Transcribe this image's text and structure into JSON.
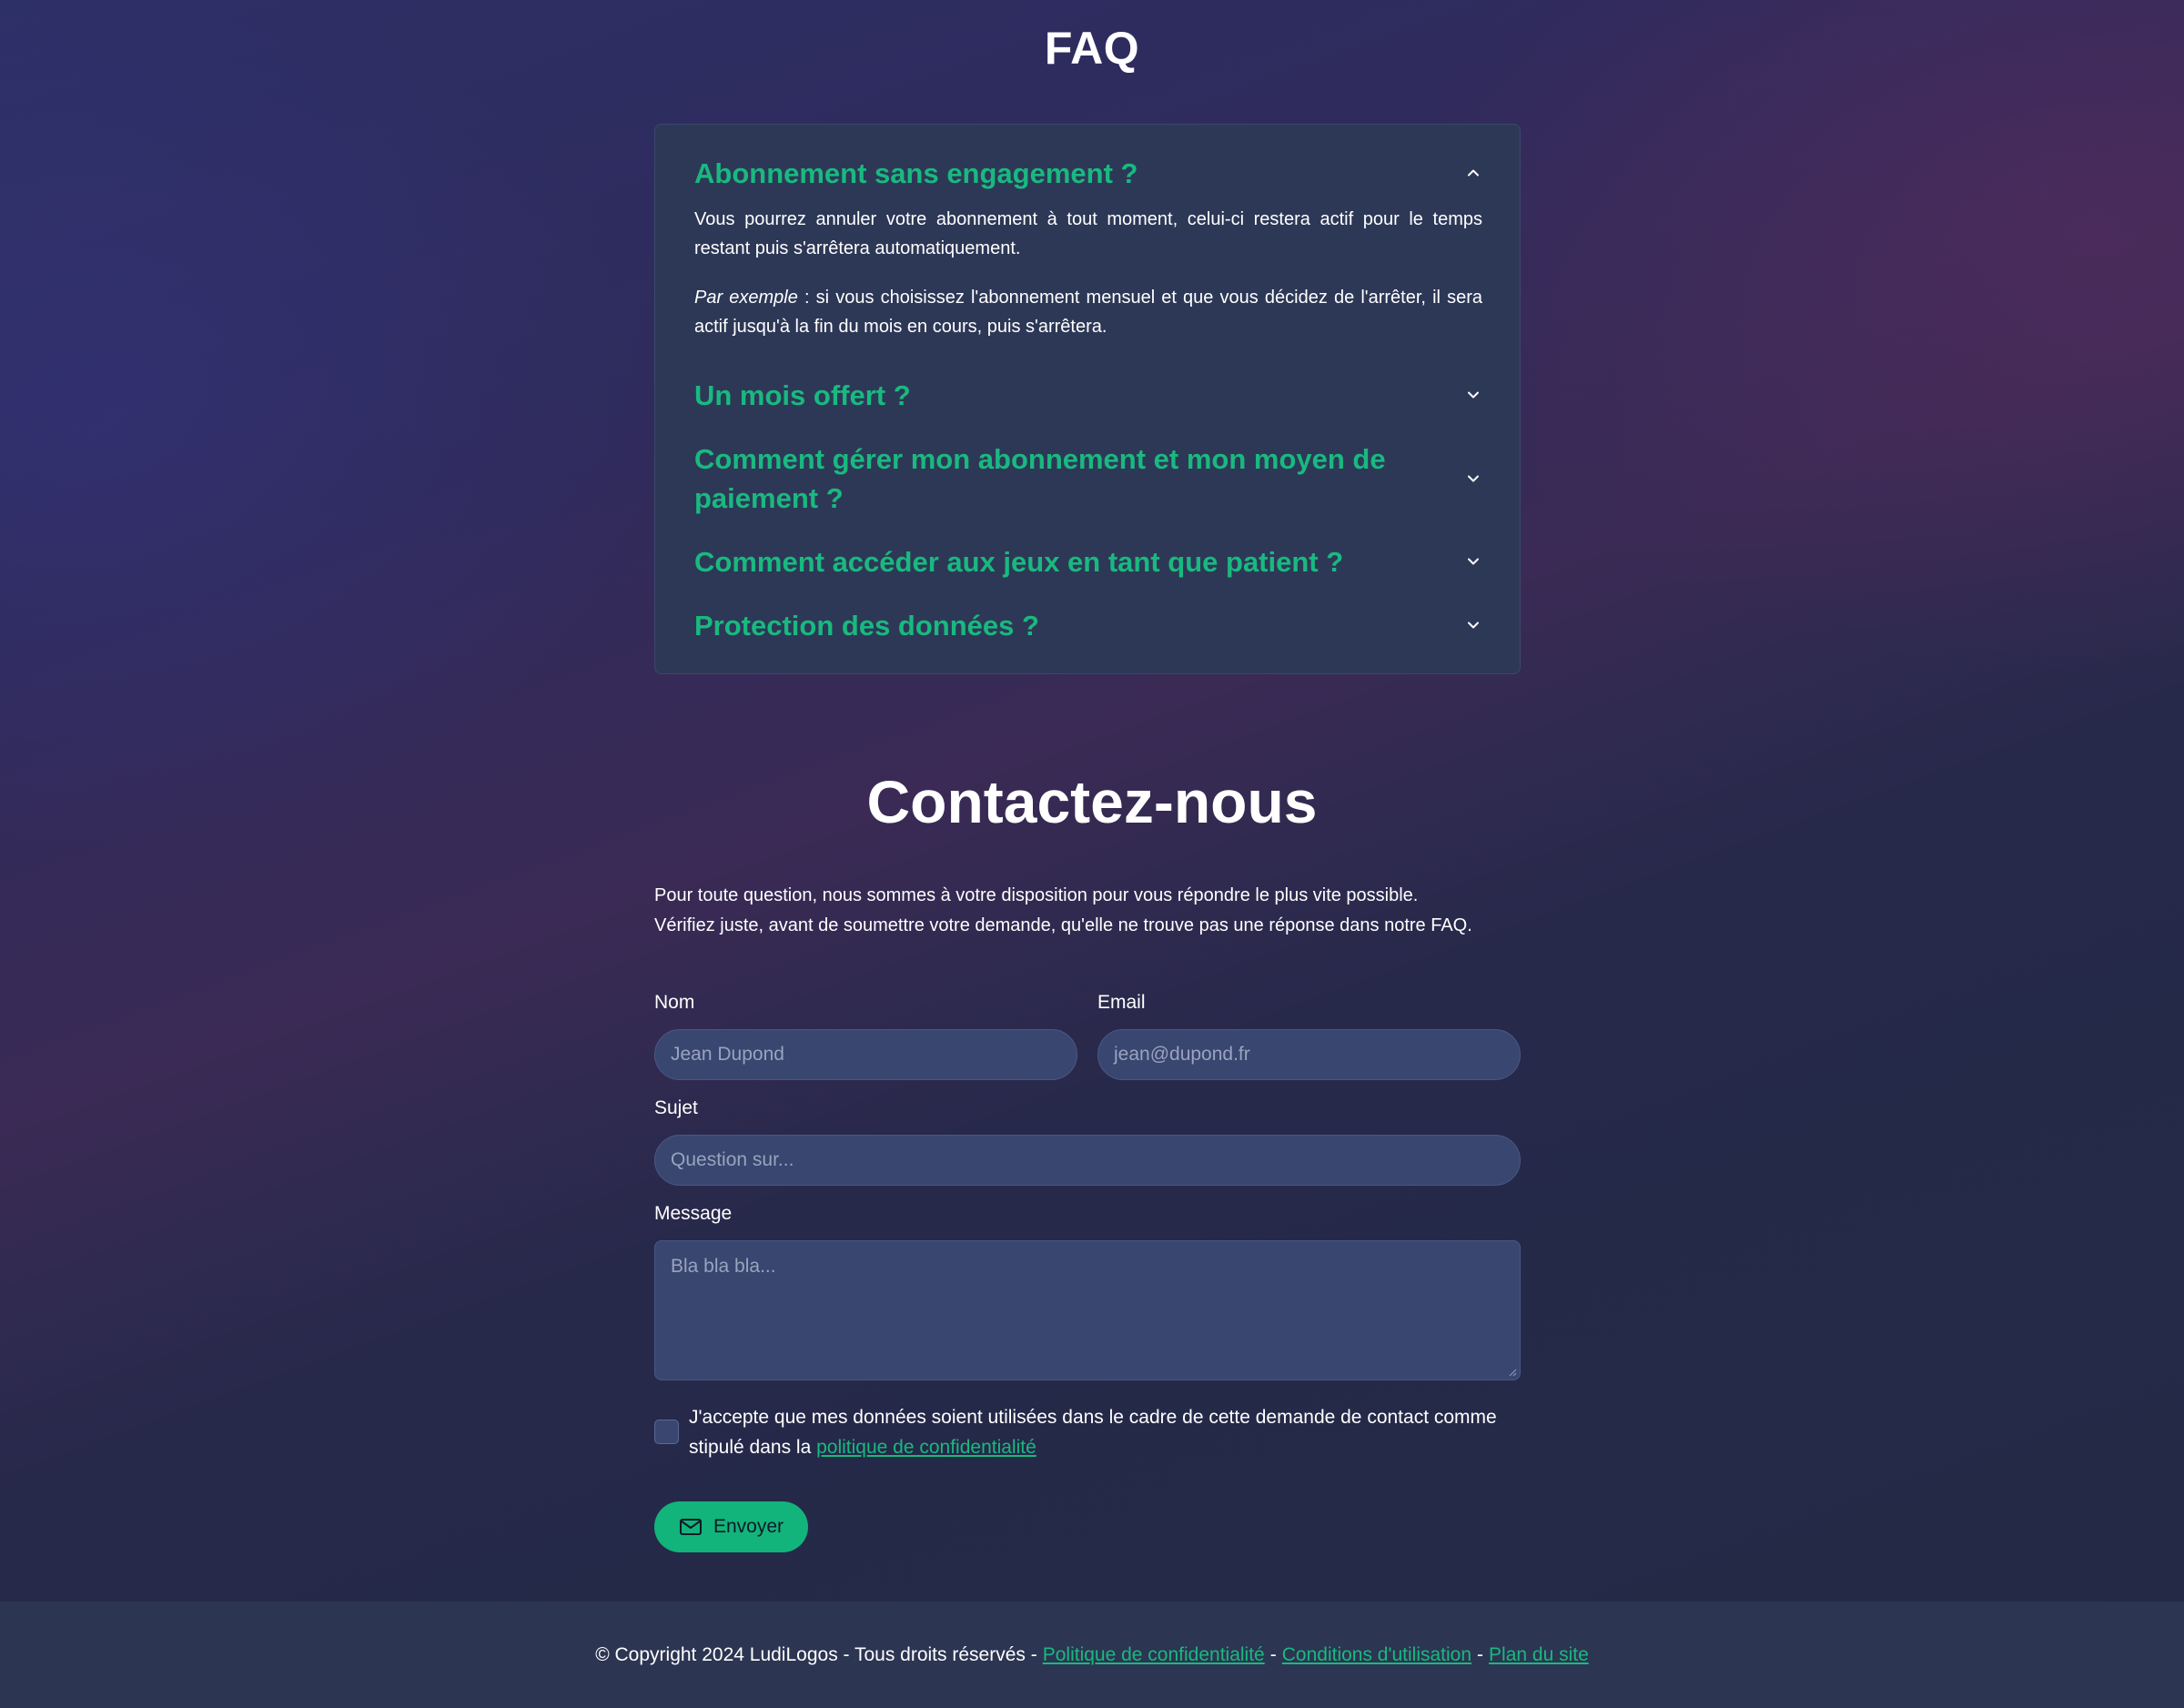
{
  "faq": {
    "title": "FAQ",
    "items": [
      {
        "question": "Abonnement sans engagement ?",
        "expanded": true,
        "answer_p1": "Vous pourrez annuler votre abonnement à tout moment, celui-ci restera actif pour le temps restant puis s'arrêtera automatiquement.",
        "answer_p2_em": "Par exemple",
        "answer_p2_rest": " : si vous choisissez l'abonnement mensuel et que vous décidez de l'arrêter, il sera actif jusqu'à la fin du mois en cours, puis s'arrêtera."
      },
      {
        "question": "Un mois offert ?",
        "expanded": false
      },
      {
        "question": "Comment gérer mon abonnement et mon moyen de paiement ?",
        "expanded": false
      },
      {
        "question": "Comment accéder aux jeux en tant que patient ?",
        "expanded": false
      },
      {
        "question": "Protection des données ?",
        "expanded": false
      }
    ]
  },
  "contact": {
    "title": "Contactez-nous",
    "intro_line1": "Pour toute question, nous sommes à votre disposition pour vous répondre le plus vite possible.",
    "intro_line2": "Vérifiez juste, avant de soumettre votre demande, qu'elle ne trouve pas une réponse dans notre FAQ.",
    "name_label": "Nom",
    "name_placeholder": "Jean Dupond",
    "email_label": "Email",
    "email_placeholder": "jean@dupond.fr",
    "subject_label": "Sujet",
    "subject_placeholder": "Question sur...",
    "message_label": "Message",
    "message_placeholder": "Bla bla bla...",
    "consent_text": "J'accepte que mes données soient utilisées dans le cadre de cette demande de contact comme stipulé dans la ",
    "consent_link": "politique de confidentialité",
    "consent_checked": false,
    "submit_label": "Envoyer"
  },
  "footer": {
    "copyright": "© Copyright 2024 LudiLogos - Tous droits réservés -",
    "privacy_link": "Politique de confidentialité",
    "sep": "-",
    "terms_link": "Conditions d'utilisation",
    "sitemap_link": "Plan du site"
  },
  "colors": {
    "accent": "#19b97f",
    "button": "#12b47b",
    "card": "#2d3857",
    "input": "#384670",
    "footer": "#2c3552"
  },
  "icons": {
    "expanded": "chevron-up-icon",
    "collapsed": "chevron-down-icon",
    "submit": "envelope-icon"
  }
}
